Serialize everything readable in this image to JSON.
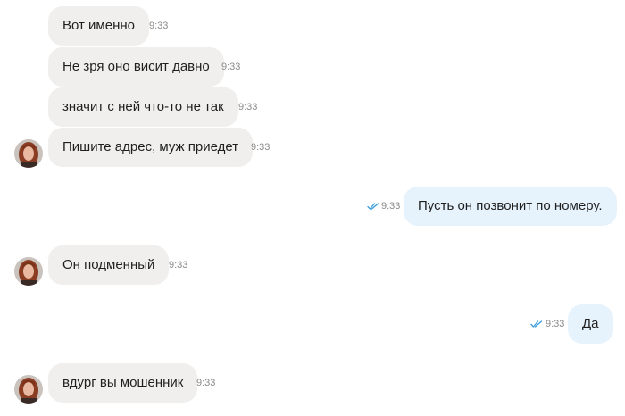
{
  "chat": {
    "messages": [
      {
        "text": "Вот именно",
        "time": "9:33",
        "direction": "incoming"
      },
      {
        "text": "Не зря оно висит давно",
        "time": "9:33",
        "direction": "incoming"
      },
      {
        "text": "значит с ней что-то не так",
        "time": "9:33",
        "direction": "incoming"
      },
      {
        "text": "Пишите адрес, муж приедет",
        "time": "9:33",
        "direction": "incoming",
        "avatar": "woman-avatar"
      },
      {
        "text": "Пусть он позвонит по номеру.",
        "time": "9:33",
        "direction": "outgoing",
        "status": "read-double-check-icon"
      },
      {
        "text": "Он подменный",
        "time": "9:33",
        "direction": "incoming",
        "avatar": "woman-avatar"
      },
      {
        "text": "Да",
        "time": "9:33",
        "direction": "outgoing",
        "status": "read-double-check-icon"
      },
      {
        "text": "вдург вы мошенник",
        "time": "9:33",
        "direction": "incoming",
        "avatar": "woman-avatar"
      }
    ]
  },
  "colors": {
    "incoming_bubble": "#f0efed",
    "outgoing_bubble": "#e6f3fd",
    "read_tick": "#3a9bdc",
    "time_text": "#8a8a8a"
  }
}
